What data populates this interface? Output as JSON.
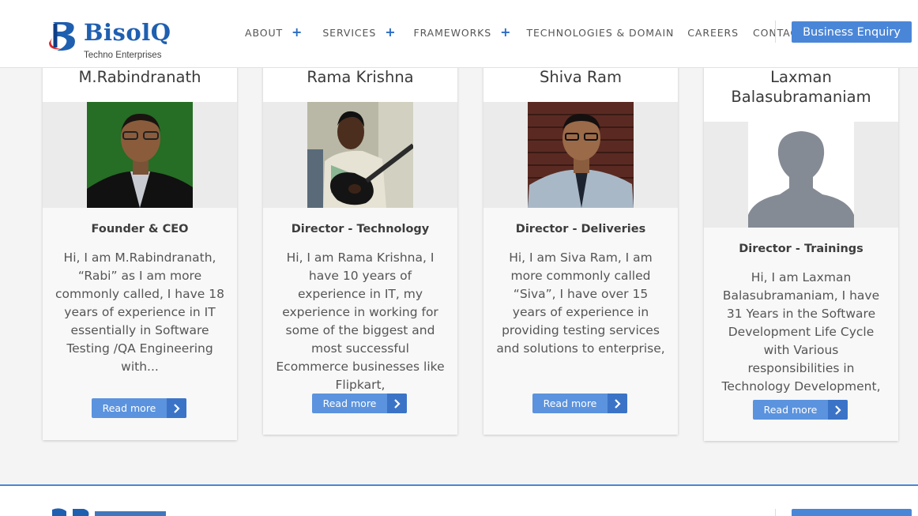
{
  "brand": {
    "name": "BisolQ",
    "tagline": "Techno Enterprises"
  },
  "nav": {
    "items": [
      {
        "label": "ABOUT",
        "has_submenu": true
      },
      {
        "label": "SERVICES",
        "has_submenu": true
      },
      {
        "label": "FRAMEWORKS",
        "has_submenu": true
      },
      {
        "label": "TECHNOLOGIES & DOMAIN",
        "has_submenu": false
      },
      {
        "label": "CAREERS",
        "has_submenu": false
      },
      {
        "label": "CONTACT",
        "has_submenu": false
      }
    ],
    "submenu_icon": "plus-icon",
    "cta": "Business Enquiry"
  },
  "team": [
    {
      "name": "M.Rabindranath",
      "role": "Founder & CEO",
      "bio": "Hi, I am M.Rabindranath, “Rabi” as I am more commonly called, I have 18 years of experience in IT essentially in Software Testing /QA Engineering with...",
      "button": "Read more"
    },
    {
      "name": "Rama Krishna",
      "role": "Director - Technology",
      "bio": "Hi, I am Rama Krishna, I have 10 years of experience in IT, my experience in working for some of the biggest and most successful Ecommerce businesses like Flipkart,",
      "button": "Read more"
    },
    {
      "name": "Shiva Ram",
      "role": "Director - Deliveries",
      "bio": "Hi, I am Siva Ram, I am more commonly called “Siva”, I have over 15 years of experience in providing testing services and solutions to enterprise,",
      "button": "Read more"
    },
    {
      "name": "Laxman Balasubramaniam",
      "role": "Director - Trainings",
      "bio": "Hi, I am Laxman Balasubramaniam, I have 31 Years in the Software Development Life Cycle with Various responsibilities in Technology Development,",
      "button": "Read more"
    }
  ],
  "colors": {
    "accent": "#4a86d8",
    "button": "#5b93de",
    "button_arrow": "#3b74c7",
    "brand": "#1f5fb0"
  }
}
